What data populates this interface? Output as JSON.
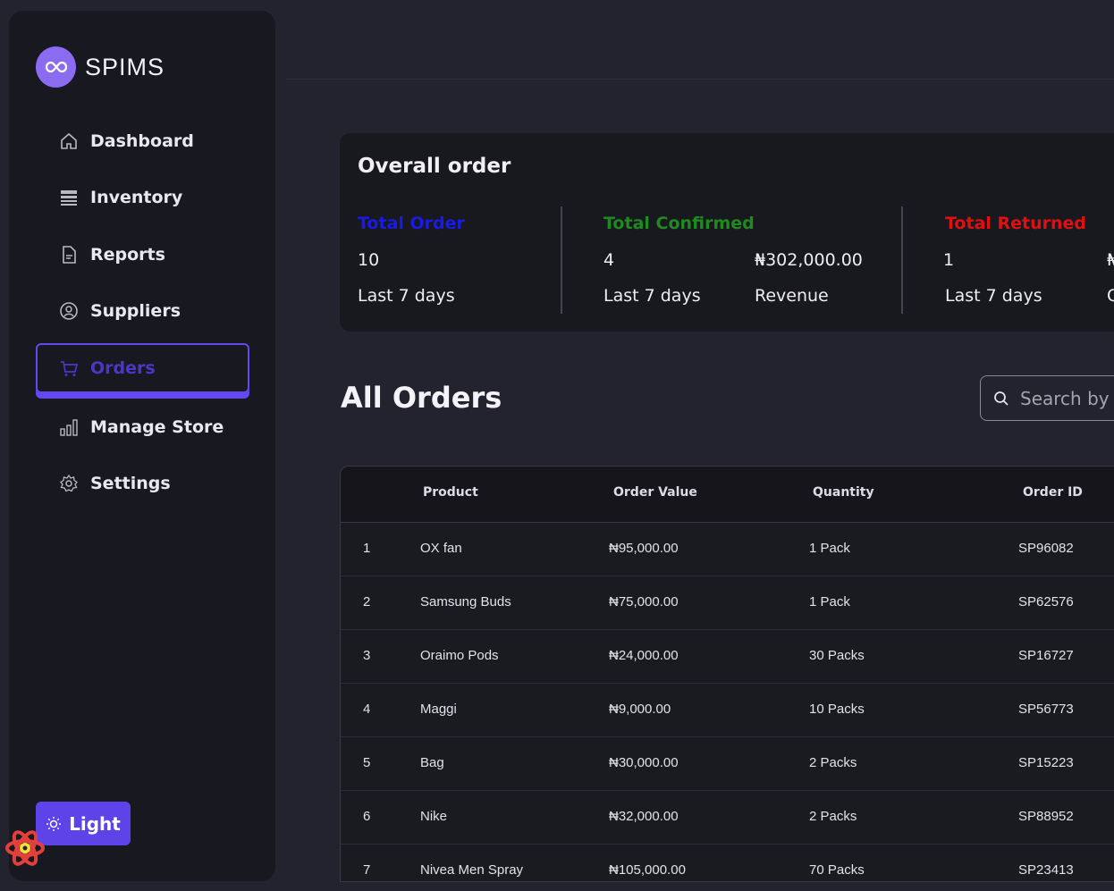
{
  "app": {
    "name": "SPIMS"
  },
  "sidebar": {
    "items": [
      {
        "label": "Dashboard",
        "icon": "home-icon"
      },
      {
        "label": "Inventory",
        "icon": "inventory-icon"
      },
      {
        "label": "Reports",
        "icon": "report-icon"
      },
      {
        "label": "Suppliers",
        "icon": "user-circle-icon"
      },
      {
        "label": "Orders",
        "icon": "cart-icon",
        "active": true
      },
      {
        "label": "Manage Store",
        "icon": "bar-chart-icon"
      },
      {
        "label": "Settings",
        "icon": "gear-icon"
      }
    ],
    "theme_toggle": "Light"
  },
  "overall": {
    "title": "Overall order",
    "total_order": {
      "label": "Total Order",
      "value": "10",
      "period": "Last 7 days",
      "color": "#1a1ae6"
    },
    "total_confirmed": {
      "label": "Total Confirmed",
      "value": "4",
      "period": "Last 7 days",
      "revenue": "₦302,000.00",
      "revenue_label": "Revenue",
      "color": "#1f8a1f"
    },
    "total_returned": {
      "label": "Total Returned",
      "value": "1",
      "period": "Last 7 days",
      "revenue_partial": "₦",
      "revenue_label_partial": "C",
      "color": "#e01010"
    }
  },
  "orders": {
    "title": "All Orders",
    "search_placeholder": "Search by",
    "columns": [
      "Product",
      "Order Value",
      "Quantity",
      "Order ID"
    ],
    "rows": [
      {
        "n": "1",
        "product": "OX fan",
        "value": "₦95,000.00",
        "qty": "1 Pack",
        "id": "SP96082"
      },
      {
        "n": "2",
        "product": "Samsung Buds",
        "value": "₦75,000.00",
        "qty": "1 Pack",
        "id": "SP62576"
      },
      {
        "n": "3",
        "product": "Oraimo Pods",
        "value": "₦24,000.00",
        "qty": "30 Packs",
        "id": "SP16727"
      },
      {
        "n": "4",
        "product": "Maggi",
        "value": "₦9,000.00",
        "qty": "10 Packs",
        "id": "SP56773"
      },
      {
        "n": "5",
        "product": "Bag",
        "value": "₦30,000.00",
        "qty": "2 Packs",
        "id": "SP15223"
      },
      {
        "n": "6",
        "product": "Nike",
        "value": "₦32,000.00",
        "qty": "2 Packs",
        "id": "SP88952"
      },
      {
        "n": "7",
        "product": "Nivea Men Spray",
        "value": "₦105,000.00",
        "qty": "70 Packs",
        "id": "SP23413"
      }
    ]
  }
}
